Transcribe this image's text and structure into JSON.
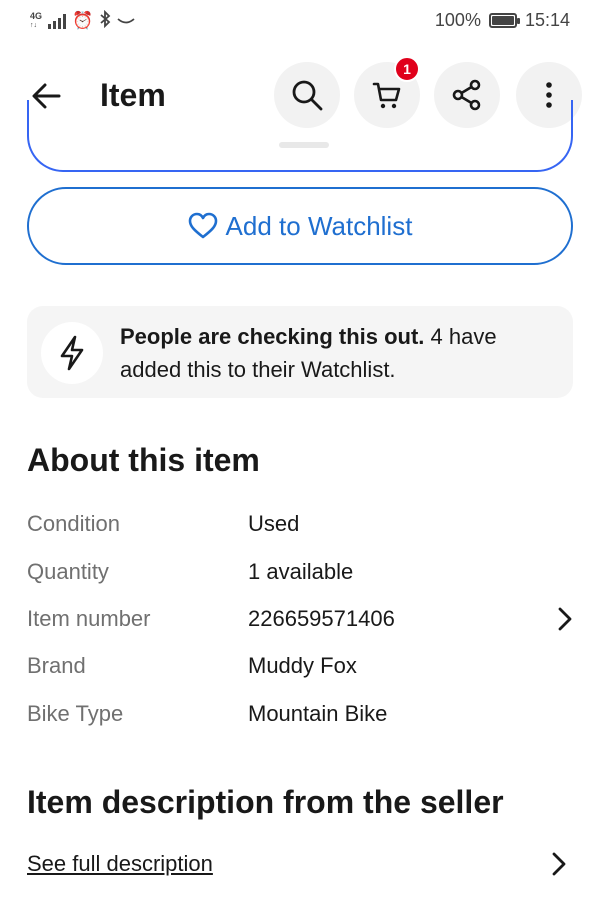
{
  "status_bar": {
    "network_label": "4G",
    "network_sub": "↑↓",
    "battery_percent": "100%",
    "battery_level": 1.0,
    "time": "15:14",
    "icons": [
      "signal-icon",
      "alarm-icon",
      "bluetooth-icon",
      "nfc-icon",
      "battery-icon"
    ]
  },
  "header": {
    "title": "Item",
    "cart_count": "1",
    "icons": [
      "back-arrow-icon",
      "search-icon",
      "cart-icon",
      "share-icon",
      "more-vertical-icon"
    ]
  },
  "watch_button": {
    "label": "Add to Watchlist",
    "icon": "heart-icon"
  },
  "info_card": {
    "bold_text": "People are checking this out.",
    "rest_text": " 4 have added this to their Watchlist.",
    "icon": "lightning-icon"
  },
  "about": {
    "title": "About this item",
    "rows": [
      {
        "label": "Condition",
        "value": "Used"
      },
      {
        "label": "Quantity",
        "value": "1 available"
      },
      {
        "label": "Item number",
        "value": "226659571406"
      },
      {
        "label": "Brand",
        "value": "Muddy Fox"
      },
      {
        "label": "Bike Type",
        "value": "Mountain Bike"
      }
    ]
  },
  "description": {
    "title": "Item description from the seller",
    "link": "See full description"
  },
  "colors": {
    "accent_blue": "#1f6fd0",
    "badge_red": "#e0001b",
    "text_primary": "#191919",
    "text_secondary": "#707070",
    "card_bg": "#f5f5f5"
  }
}
